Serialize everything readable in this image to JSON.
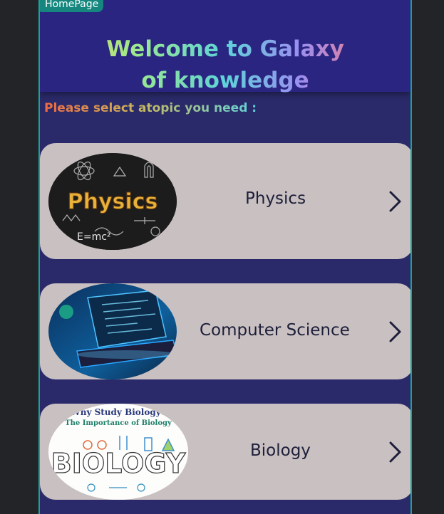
{
  "header": {
    "home_badge": "HomePage",
    "title_line1": "Welcome to Galaxy",
    "title_line2": "of knowledge"
  },
  "prompt": "Please select atopic you need :",
  "topics": [
    {
      "label": "Physics",
      "image_text": "Physics",
      "image_formula": "E=mc²",
      "icon": "physics-image"
    },
    {
      "label": "Computer Science",
      "icon": "computer-science-image"
    },
    {
      "label": "Biology",
      "image_title": "Why Study Biology?",
      "image_subtitle": "The Importance of Biology",
      "image_word": "BIOLOGY",
      "icon": "biology-image"
    }
  ],
  "colors": {
    "background": "#232427",
    "panel": "#2a2a6a",
    "header": "#2a2581",
    "card": "#c9c0c1",
    "accent": "#15877f"
  }
}
